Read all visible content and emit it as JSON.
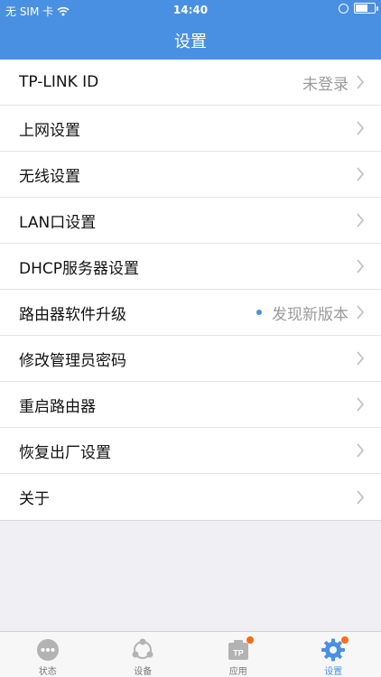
{
  "status_bar": {
    "carrier": "无 SIM 卡",
    "time": "14:40"
  },
  "nav": {
    "title": "设置"
  },
  "settings": {
    "items": [
      {
        "label": "TP-LINK ID",
        "value": "未登录"
      },
      {
        "label": "上网设置"
      },
      {
        "label": "无线设置"
      },
      {
        "label": "LAN口设置"
      },
      {
        "label": "DHCP服务器设置"
      },
      {
        "label": "路由器软件升级",
        "value": "发现新版本"
      },
      {
        "label": "修改管理员密码"
      },
      {
        "label": "重启路由器"
      },
      {
        "label": "恢复出厂设置"
      },
      {
        "label": "关于"
      }
    ]
  },
  "tabbar": {
    "tabs": [
      {
        "label": "状态",
        "icon": "status-dots-icon"
      },
      {
        "label": "设备",
        "icon": "devices-icon"
      },
      {
        "label": "应用",
        "icon": "tp-apps-icon"
      },
      {
        "label": "设置",
        "icon": "gear-icon"
      }
    ],
    "active_tab": "设置"
  },
  "colors": {
    "accent": "#4a90e2",
    "badge": "#ff6a1a",
    "inactive_icon": "#b3b3b3"
  }
}
